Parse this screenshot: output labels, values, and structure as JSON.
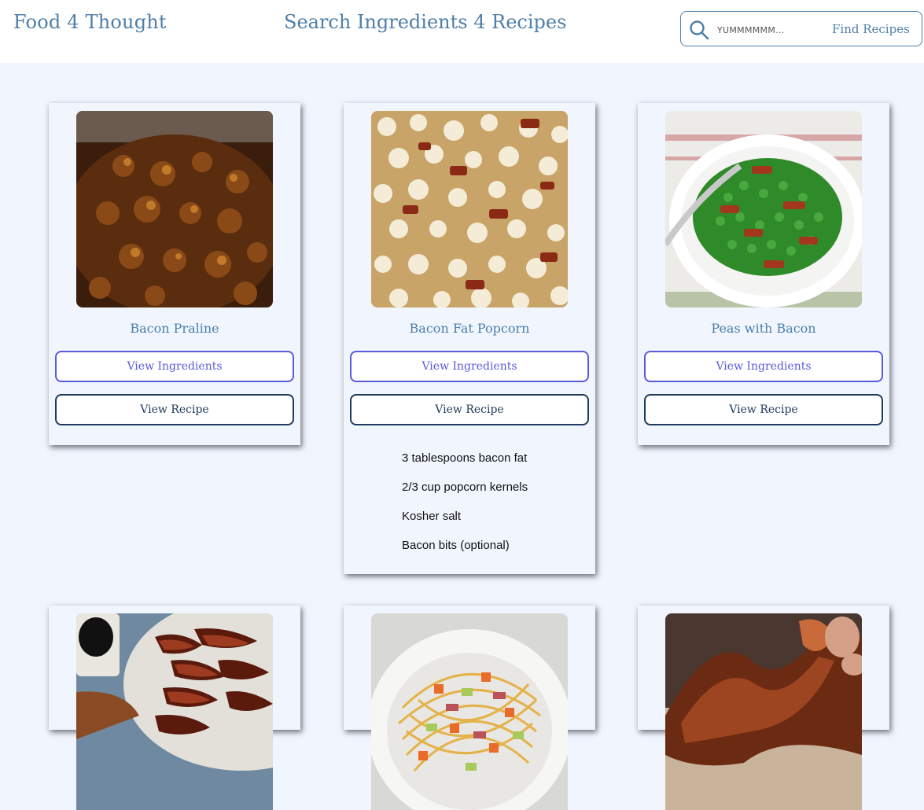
{
  "header": {
    "brand": "Food 4 Thought",
    "headline": "Search Ingredients 4 Recipes",
    "search": {
      "placeholder": "YUMMMMMM...",
      "value": "",
      "button_label": "Find Recipes"
    }
  },
  "common": {
    "view_ingredients_label": "View Ingredients",
    "view_recipe_label": "View Recipe"
  },
  "recipes": [
    {
      "title": "Bacon Praline",
      "ingredients": []
    },
    {
      "title": "Bacon Fat Popcorn",
      "ingredients": [
        "3 tablespoons bacon fat",
        "2/3 cup popcorn kernels",
        "Kosher salt",
        "Bacon bits (optional)"
      ]
    },
    {
      "title": "Peas with Bacon",
      "ingredients": []
    },
    {
      "title": "",
      "ingredients": []
    },
    {
      "title": "",
      "ingredients": []
    },
    {
      "title": "",
      "ingredients": []
    }
  ],
  "colors": {
    "brand": "#4e7fa9",
    "page_bg": "#f0f5fe",
    "ingredient_button": "#5a5adc",
    "recipe_button": "#1e3a5c"
  }
}
